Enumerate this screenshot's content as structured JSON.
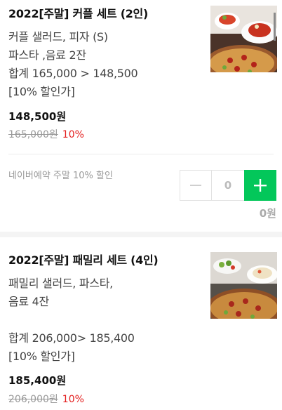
{
  "products": [
    {
      "title": "2022[주말] 커플 세트 (2인)",
      "desc_lines": [
        "커플 샐러드, 피자 (S)",
        "파스타 ,음료 2잔",
        "합계 165,000 > 148,500",
        "[10% 할인가]"
      ],
      "price": "148,500원",
      "original_price": "165,000원",
      "discount": "10%",
      "image_icon": "food-photo-pizza-pasta"
    },
    {
      "title": "2022[주말] 패밀리 세트 (4인)",
      "desc_lines": [
        "패밀리 샐러드, 파스타,",
        "음료 4잔",
        "",
        "합계 206,000> 185,400",
        "[10% 할인가]"
      ],
      "price": "185,400원",
      "original_price": "206,000원",
      "discount": "10%",
      "image_icon": "food-photo-pizza-salad"
    }
  ],
  "booking": {
    "note": "네이버예약 주말 10% 할인",
    "quantity": "0",
    "line_total": "0원"
  },
  "colors": {
    "accent": "#03c75a",
    "discount": "#e31e1e"
  }
}
